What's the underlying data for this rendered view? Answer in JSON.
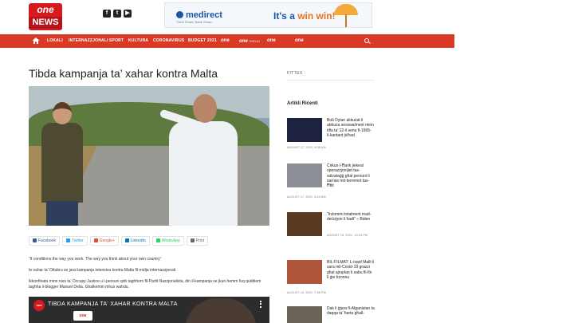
{
  "header": {
    "logo_top": "one",
    "logo_bottom": "NEWS",
    "ad": {
      "brand": "medirect",
      "tagline": "Think Smart, Bank Smart",
      "slogan_start": "It's a ",
      "slogan_accent": "win win!"
    }
  },
  "nav": {
    "items": [
      "LOKALI",
      "INTERNAZZJONALI",
      "SPORT",
      "KULTURA",
      "CORONAVIRUS",
      "BUDGET 2021"
    ],
    "channels": [
      {
        "label": "one",
        "sub": ""
      },
      {
        "label": "one",
        "sub": "RADJU"
      },
      {
        "label": "one",
        "sub": ""
      }
    ],
    "colors": {
      "bar": "#d83a26",
      "brand": "#d71920"
    }
  },
  "article": {
    "title": "Tibda kampanja ta’ xahar kontra Malta",
    "share_buttons": [
      {
        "label": "Facebook",
        "color": "#3b5998"
      },
      {
        "label": "Twitter",
        "color": "#1da1f2"
      },
      {
        "label": "Google+",
        "color": "#dd4b39"
      },
      {
        "label": "LinkedIn",
        "color": "#0077b5"
      },
      {
        "label": "WhatsApp",
        "color": "#25d366"
      },
      {
        "label": "Print",
        "color": "#666666"
      }
    ],
    "paragraphs": [
      "“It conditions the way you work. The way you think about your own country”",
      "Ie xahar ta’ Ottubru se jara kampanja intensiva kontra Malta fil-midja internazzjonali.",
      "Ikkonfinata minn nies ta’ Occupy Justice u l-persuni qrib taghhom fil-Partit Nazzjonalista, din il-kampanja se jkun hemm fuq quddiem taghha il-blogger Manuel Delia. Ghalkemm mhux wahdu."
    ],
    "video": {
      "title": "TIBDA KAMPANJA TA' XAHAR KONTRA MALTA",
      "channel_logo": "one",
      "inset_logo": "one"
    }
  },
  "sidebar": {
    "search_label": "FITTEX",
    "heading": "Artikli Riċenti",
    "items": [
      {
        "title": "Bob Dylan akkużat li abbuża sesswalment minn tifla ta’ 12-il sena fl-1965- il-kantant jiċħad",
        "date": "AUGUST 17, 2021, 8:38 AM"
      },
      {
        "title": "Ċirkun l-Ħarik jiekeal operazzjonijiet tas-salvataġġ għal persuni li sarraw mit-terremot tas-Ħtiti",
        "date": "AUGUST 17, 2021, 8:24 AM"
      },
      {
        "title": "“Inżommi totalment mad-deċiżjoni li ħadt” – Biden",
        "date": "AUGUST 16, 2021, 10:24 PM"
      },
      {
        "title": "BIL-FILMAT: L-isqof Mallt li sara mil-Covid-19 grazzi għal ajruplan li sabu fil-fin li ġie bżonnu",
        "date": "AUGUST 16, 2021, 7:56 PM"
      },
      {
        "title": "Dak li jġara fl-Afganistan ta daqqa ta’ ħarta għall-",
        "date": ""
      }
    ]
  }
}
